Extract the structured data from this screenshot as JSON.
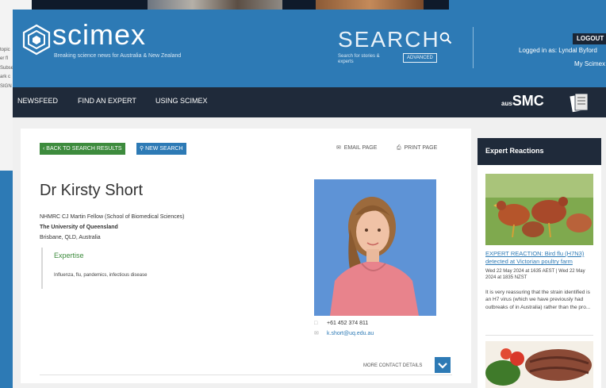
{
  "background": {
    "left_text": [
      "topic",
      "er fl",
      "Subse",
      "",
      "ark c",
      "SIGN"
    ]
  },
  "header": {
    "logo_text": "scimex",
    "tagline": "Breaking science news for Australia & New Zealand",
    "search_word": "SEARCH",
    "search_sub": "Search for stories & experts",
    "advanced_label": "ADVANCED",
    "logout_label": "LOGOUT",
    "logged_in_text": "Logged in as: Lyndal Byford",
    "my_scimex_label": "My Scimex"
  },
  "nav": {
    "items": [
      "NEWSFEED",
      "FIND AN EXPERT",
      "USING SCIMEX"
    ],
    "partner_logo_small": "aus",
    "partner_logo_big": "SMC"
  },
  "toolbar": {
    "back_label": "BACK TO SEARCH RESULTS",
    "new_search_label": "NEW SEARCH",
    "email_label": "EMAIL PAGE",
    "print_label": "PRINT PAGE"
  },
  "expert": {
    "name": "Dr Kirsty Short",
    "position": "NHMRC CJ Martin Fellow (School of Biomedical Sciences)",
    "organisation": "The University of Queensland",
    "location": "Brisbane, QLD, Australia",
    "expertise_title": "Expertise",
    "expertise_topics": "Influenza, flu, pandemics, infectious disease",
    "phone": "+61 452 374 811",
    "email": "k.short@uq.edu.au",
    "more_contact_label": "MORE CONTACT DETAILS"
  },
  "sidebar": {
    "title": "Expert Reactions",
    "reaction_title": "EXPERT REACTION: Bird flu (H7N3) detected at Victorian poultry farm",
    "reaction_date": "Wed 22 May 2024 at 1635 AEST | Wed 22 May 2024 at 1835 NZST",
    "reaction_excerpt": "It is very reassuring that the strain identified is an H7 virus (which we have previously had outbreaks of in Australia) rather than the pro..."
  },
  "colors": {
    "brand_blue": "#2d7ab5",
    "nav_dark": "#1f2a3a",
    "back_green": "#3d8b3d"
  },
  "icons": {
    "search": "search-icon",
    "chevron_left": "chevron-left-icon",
    "email": "envelope-icon",
    "print": "printer-icon",
    "phone": "phone-icon",
    "mail": "mail-icon",
    "chevron_down": "chevron-down-icon"
  }
}
